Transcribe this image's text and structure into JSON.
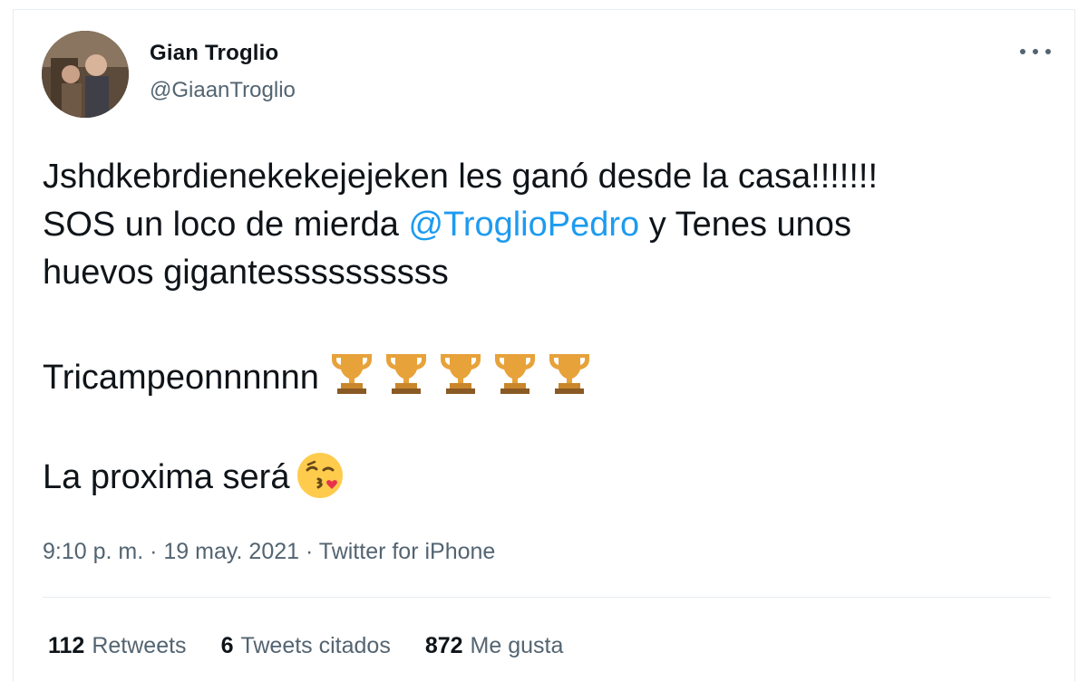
{
  "author": {
    "name": "Gian Troglio",
    "handle": "@GiaanTroglio"
  },
  "tweet": {
    "line1": "Jshdkebrdienekekejejeken les ganó desde la casa!!!!!!!",
    "line2_before": "SOS un loco de mierda ",
    "mention": "@TroglioPedro",
    "line2_after": " y Tenes unos",
    "line3": "huevos gigantessssssssss",
    "line4": "Tricampeonnnnnn",
    "line4_icons": [
      "trophy-emoji",
      "trophy-emoji",
      "trophy-emoji",
      "trophy-emoji",
      "trophy-emoji"
    ],
    "line5": "La proxima será",
    "line5_icon": "face-blowing-kiss-emoji"
  },
  "meta": {
    "time": "9:10 p. m.",
    "separator": " · ",
    "date": "19 may. 2021",
    "source": "Twitter for iPhone"
  },
  "stats": {
    "retweets_count": "112",
    "retweets_label": "Retweets",
    "quotes_count": "6",
    "quotes_label": "Tweets citados",
    "likes_count": "872",
    "likes_label": "Me gusta"
  },
  "colors": {
    "link": "#1d9bf0",
    "secondary_text": "#536471",
    "primary_text": "#0f1419",
    "divider": "#e6ecf0"
  }
}
